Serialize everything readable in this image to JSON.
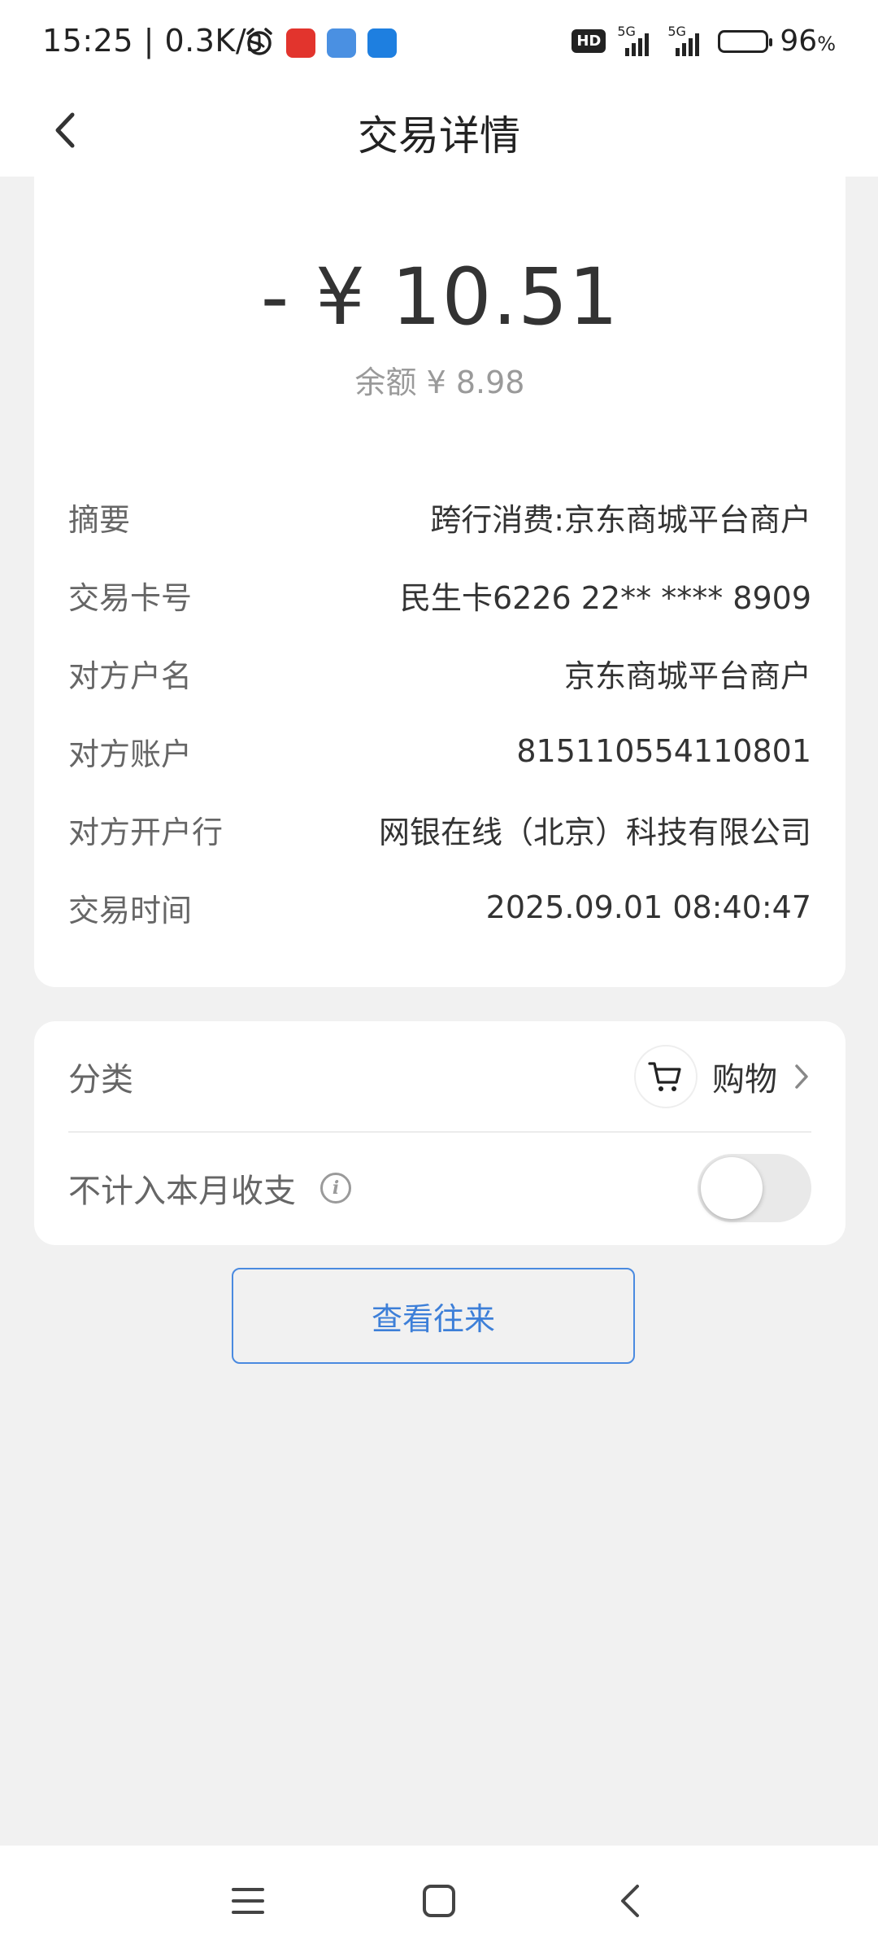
{
  "status_bar": {
    "time_speed": "15:25 | 0.3K/s",
    "hd_label": "HD",
    "net1": "5G",
    "net2": "5G",
    "battery_pct": "96",
    "battery_unit": "%",
    "battery_level": 0.96,
    "app_icons": [
      "alarm-icon",
      "toutiao-icon",
      "card-app-icon",
      "bank-app-icon"
    ]
  },
  "header": {
    "title": "交易详情"
  },
  "transaction": {
    "amount": "- ¥ 10.51",
    "balance_label": "余额",
    "balance_value": "¥ 8.98",
    "rows": [
      {
        "label": "摘要",
        "value": "跨行消费:京东商城平台商户"
      },
      {
        "label": "交易卡号",
        "value": "民生卡6226 22** **** 8909"
      },
      {
        "label": "对方户名",
        "value": "京东商城平台商户"
      },
      {
        "label": "对方账户",
        "value": "815110554110801"
      },
      {
        "label": "对方开户行",
        "value": "网银在线（北京）科技有限公司"
      },
      {
        "label": "交易时间",
        "value": "2025.09.01 08:40:47"
      }
    ]
  },
  "category": {
    "label": "分类",
    "value": "购物",
    "icon": "shopping-cart-icon"
  },
  "exclude": {
    "label": "不计入本月收支",
    "enabled": false
  },
  "actions": {
    "view_label": "查看往来"
  },
  "colors": {
    "accent": "#3d7fd8",
    "background": "#f1f1f1",
    "card": "#ffffff"
  }
}
